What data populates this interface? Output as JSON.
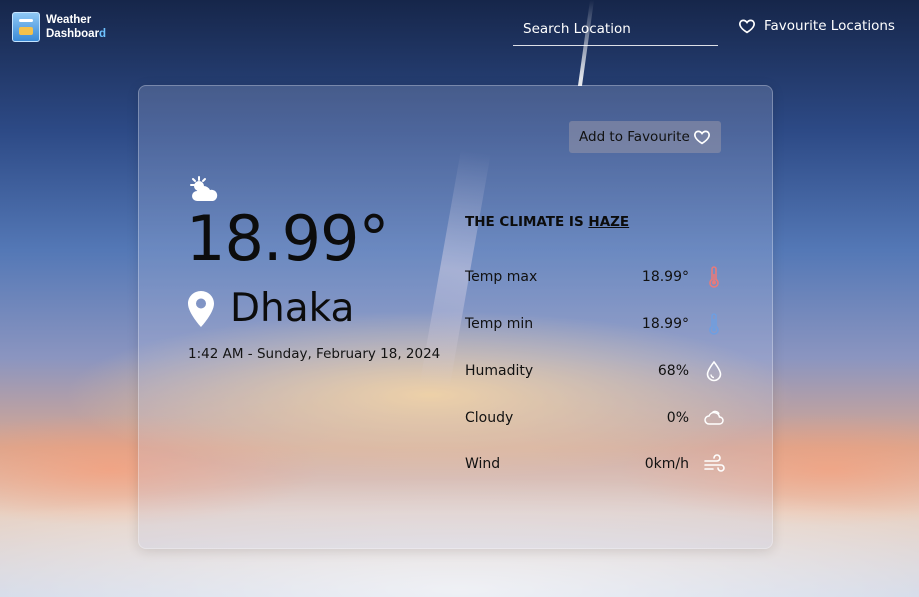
{
  "header": {
    "logo_line1": "Weather",
    "logo_line2_main": "Dashboar",
    "logo_line2_accent": "d",
    "search_placeholder": "Search Location",
    "favourites_label": "Favourite Locations"
  },
  "card": {
    "add_favourite_label": "Add to Favourite",
    "condition_icon": "partly-cloudy-icon",
    "temperature": "18.99°",
    "location": "Dhaka",
    "datetime": "1:42 AM - Sunday, February 18, 2024",
    "climate_prefix": "THE CLIMATE IS",
    "climate_value": "HAZE",
    "stats": [
      {
        "label": "Temp max",
        "value": "18.99°",
        "icon": "thermometer-hot-icon"
      },
      {
        "label": "Temp min",
        "value": "18.99°",
        "icon": "thermometer-cold-icon"
      },
      {
        "label": "Humadity",
        "value": "68%",
        "icon": "droplet-icon"
      },
      {
        "label": "Cloudy",
        "value": "0%",
        "icon": "cloud-icon"
      },
      {
        "label": "Wind",
        "value": "0km/h",
        "icon": "wind-icon"
      }
    ]
  },
  "colors": {
    "accent_blue": "#6fc3ff",
    "hot": "#e87a7a",
    "cold": "#6f9ee0"
  }
}
